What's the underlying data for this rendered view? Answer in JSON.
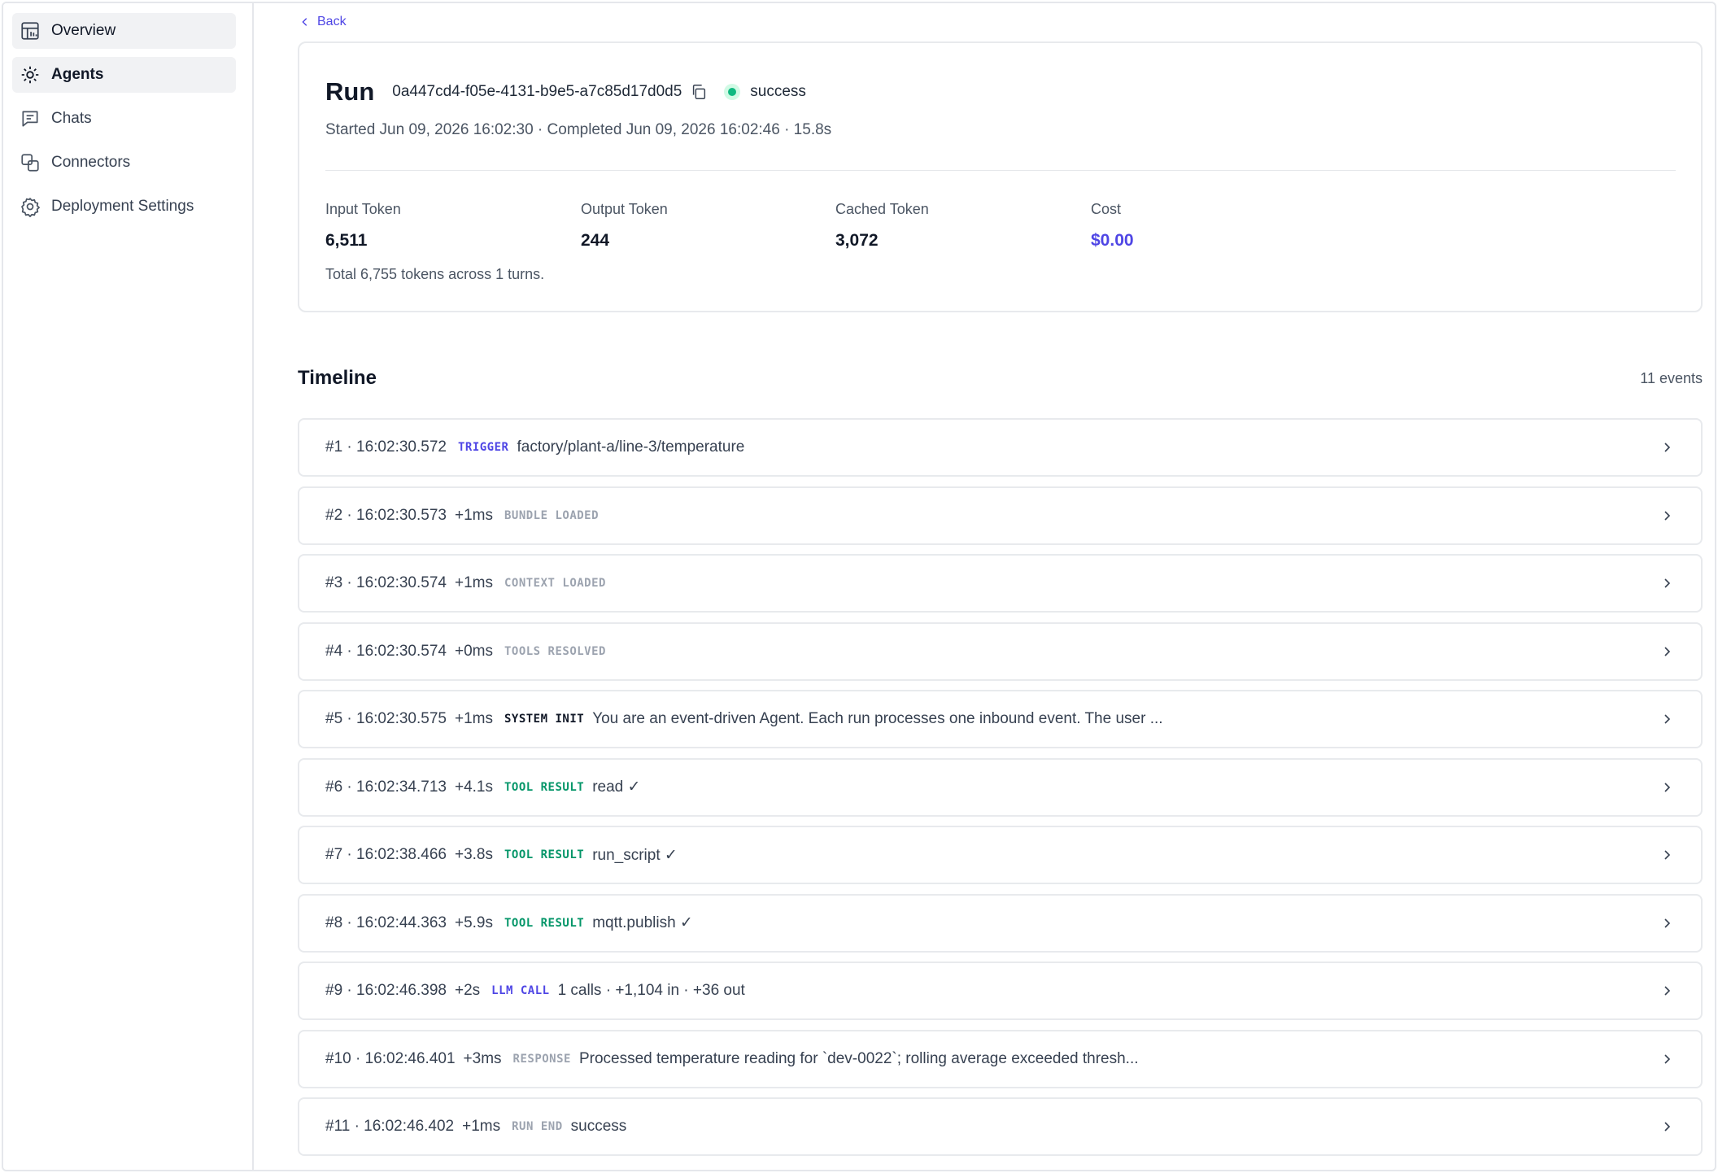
{
  "sidebar": {
    "items": [
      {
        "label": "Overview",
        "icon": "dashboard-icon"
      },
      {
        "label": "Agents",
        "icon": "agent-icon"
      },
      {
        "label": "Chats",
        "icon": "chat-icon"
      },
      {
        "label": "Connectors",
        "icon": "connectors-icon"
      },
      {
        "label": "Deployment Settings",
        "icon": "gear-icon"
      }
    ]
  },
  "header": {
    "back_label": "Back"
  },
  "run": {
    "title": "Run",
    "id": "0a447cd4-f05e-4131-b9e5-a7c85d17d0d5",
    "status": "success",
    "status_color": "#10b981",
    "meta": "Started Jun 09, 2026 16:02:30 · Completed Jun 09, 2026 16:02:46 · 15.8s"
  },
  "stats": {
    "input_label": "Input Token",
    "input_value": "6,511",
    "output_label": "Output Token",
    "output_value": "244",
    "cached_label": "Cached Token",
    "cached_value": "3,072",
    "cost_label": "Cost",
    "cost_value": "$0.00",
    "total": "Total 6,755 tokens across 1 turns."
  },
  "timeline": {
    "title": "Timeline",
    "count": "11 events",
    "events": [
      {
        "seq": "#1 · 16:02:30.572",
        "delta": "",
        "kind": "TRIGGER",
        "kind_color": "#4f46e5",
        "summary": "factory/plant-a/line-3/temperature"
      },
      {
        "seq": "#2 · 16:02:30.573",
        "delta": "+1ms",
        "kind": "BUNDLE LOADED",
        "kind_color": "#9ca3af",
        "summary": ""
      },
      {
        "seq": "#3 · 16:02:30.574",
        "delta": "+1ms",
        "kind": "CONTEXT LOADED",
        "kind_color": "#9ca3af",
        "summary": ""
      },
      {
        "seq": "#4 · 16:02:30.574",
        "delta": "+0ms",
        "kind": "TOOLS RESOLVED",
        "kind_color": "#9ca3af",
        "summary": ""
      },
      {
        "seq": "#5 · 16:02:30.575",
        "delta": "+1ms",
        "kind": "SYSTEM INIT",
        "kind_color": "#111827",
        "summary": "You are an event-driven Agent. Each run processes one inbound event. The user ..."
      },
      {
        "seq": "#6 · 16:02:34.713",
        "delta": "+4.1s",
        "kind": "TOOL RESULT",
        "kind_color": "#059669",
        "summary": "read ✓"
      },
      {
        "seq": "#7 · 16:02:38.466",
        "delta": "+3.8s",
        "kind": "TOOL RESULT",
        "kind_color": "#059669",
        "summary": "run_script ✓"
      },
      {
        "seq": "#8 · 16:02:44.363",
        "delta": "+5.9s",
        "kind": "TOOL RESULT",
        "kind_color": "#059669",
        "summary": "mqtt.publish ✓"
      },
      {
        "seq": "#9 · 16:02:46.398",
        "delta": "+2s",
        "kind": "LLM CALL",
        "kind_color": "#4f46e5",
        "summary": "1 calls · +1,104 in · +36 out"
      },
      {
        "seq": "#10 · 16:02:46.401",
        "delta": "+3ms",
        "kind": "RESPONSE",
        "kind_color": "#9ca3af",
        "summary": "Processed temperature reading for `dev-0022`; rolling average exceeded thresh..."
      },
      {
        "seq": "#11 · 16:02:46.402",
        "delta": "+1ms",
        "kind": "RUN END",
        "kind_color": "#9ca3af",
        "summary": "success"
      }
    ]
  }
}
